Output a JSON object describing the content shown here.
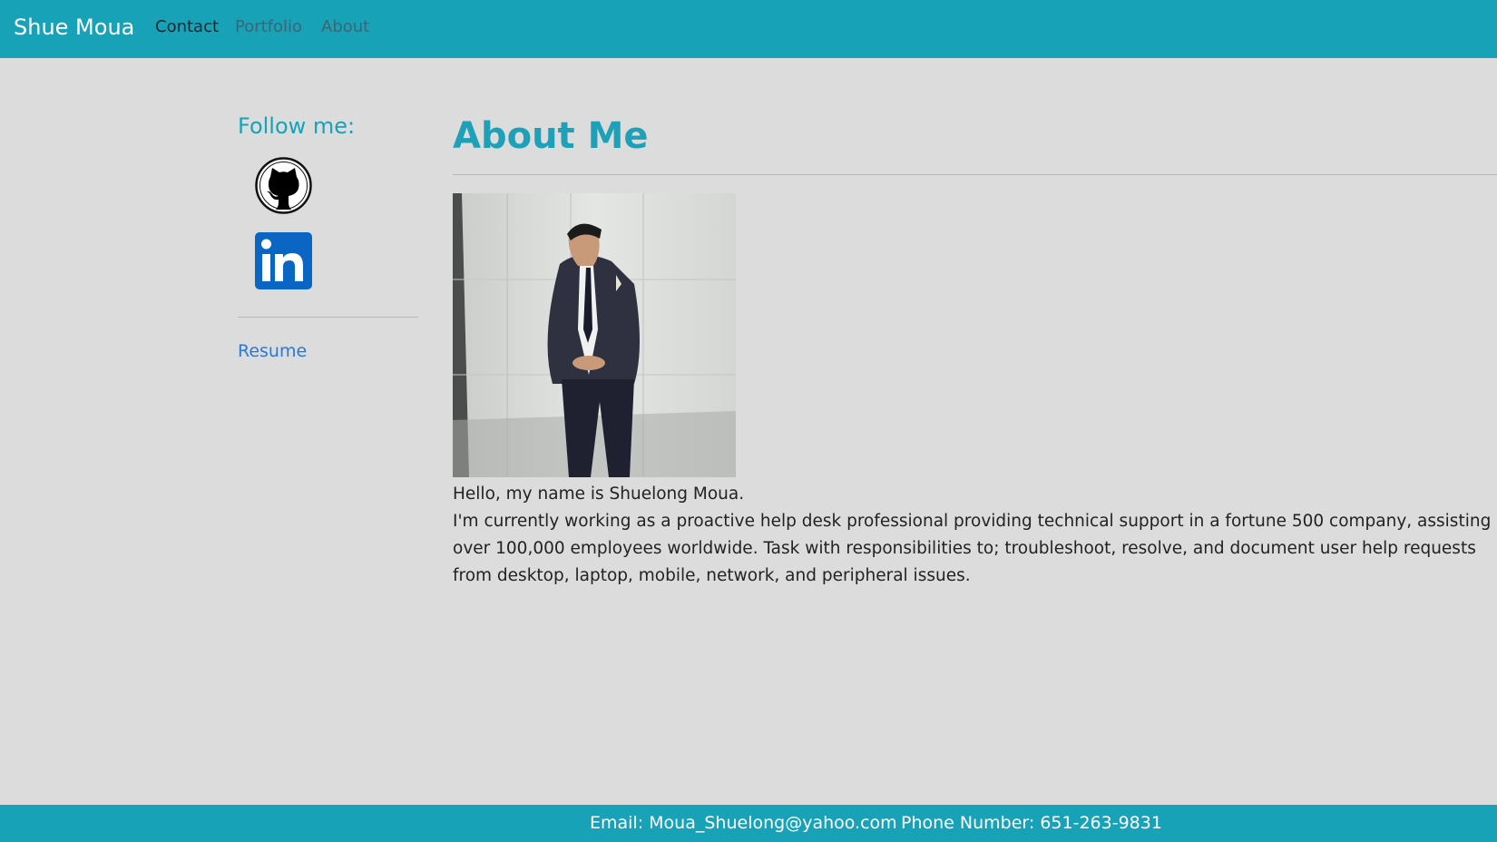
{
  "navbar": {
    "brand": "Shue Moua",
    "links": [
      {
        "label": "Contact",
        "active": true
      },
      {
        "label": "Portfolio",
        "active": false
      },
      {
        "label": "About",
        "active": false
      }
    ]
  },
  "sidebar": {
    "follow_heading": "Follow me:",
    "social": [
      {
        "icon": "github-icon"
      },
      {
        "icon": "linkedin-icon"
      }
    ],
    "resume_link": "Resume"
  },
  "main": {
    "title": "About Me",
    "photo": {
      "icon": "profile-photo"
    },
    "greeting": "Hello, my name is Shuelong Moua.",
    "bio": "I'm currently working as a proactive help desk professional providing technical support in a fortune 500 company, assisting over 100,000 employees worldwide. Task with responsibilities to; troubleshoot, resolve, and document user help requests from desktop, laptop, mobile, network, and peripheral issues."
  },
  "footer": {
    "email": "Email: Moua_Shuelong@yahoo.com",
    "phone": "Phone Number: 651-263-9831"
  },
  "colors": {
    "accent": "#17a2b8",
    "background": "#dcdcdc",
    "link": "#2a78d6",
    "linkedin": "#0a66c2"
  }
}
